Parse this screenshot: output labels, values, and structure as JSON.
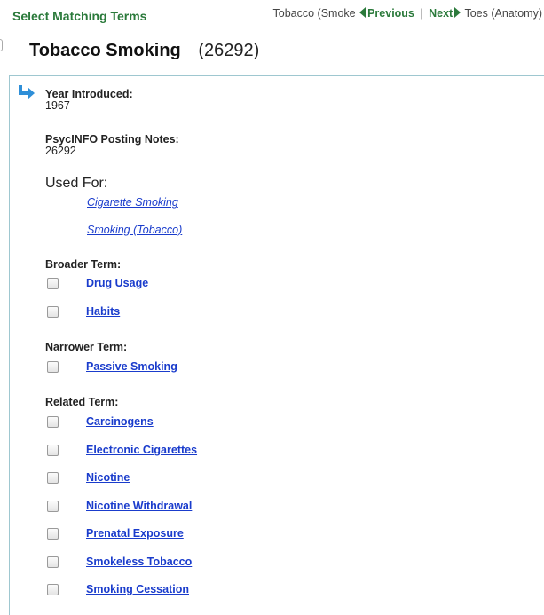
{
  "header": {
    "select_title": "Select Matching Terms",
    "prev_term": "Tobacco (Smoke",
    "previous_label": "Previous",
    "divider": "|",
    "next_label": "Next",
    "next_term": "Toes (Anatomy)"
  },
  "term": {
    "name": "Tobacco Smoking",
    "count": "(26292)"
  },
  "details": {
    "year_label": "Year Introduced:",
    "year_value": "1967",
    "posting_label": "PsycINFO Posting Notes:",
    "posting_value": "26292",
    "used_for_label": "Used For:",
    "used_for": [
      "Cigarette Smoking",
      "Smoking (Tobacco)"
    ]
  },
  "broader": {
    "label": "Broader Term:",
    "items": [
      "Drug Usage",
      "Habits"
    ]
  },
  "narrower": {
    "label": "Narrower Term:",
    "items": [
      "Passive Smoking"
    ]
  },
  "related": {
    "label": "Related Term:",
    "items": [
      "Carcinogens",
      "Electronic Cigarettes",
      "Nicotine",
      "Nicotine Withdrawal",
      "Prenatal Exposure",
      "Smokeless Tobacco",
      "Smoking Cessation"
    ]
  },
  "icons": {
    "hook": "hook-arrow-icon",
    "prev": "chevron-left-icon",
    "next": "chevron-right-icon"
  },
  "colors": {
    "accent_green": "#2b7a3b",
    "link_blue": "#1a3ccc",
    "panel_border": "#9ec7d0",
    "icon_blue": "#2f8fd8"
  }
}
